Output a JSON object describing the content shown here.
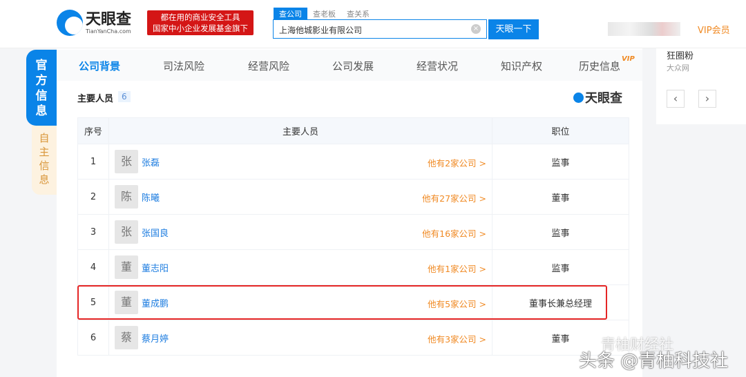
{
  "header": {
    "logo_cn": "天眼查",
    "logo_en": "TianYanCha.com",
    "slogan_line1": "都在用的商业安全工具",
    "slogan_line2": "国家中小企业发展基金旗下",
    "search_tabs": [
      "查公司",
      "查老板",
      "查关系"
    ],
    "search_value": "上海他城影业有限公司",
    "search_button": "天眼一下",
    "vip_label": "VIP会员"
  },
  "side_tabs": {
    "official": "官方信息",
    "self": "自主信息"
  },
  "nav": {
    "tabs": [
      "公司背景",
      "司法风险",
      "经营风险",
      "公司发展",
      "经营状况",
      "知识产权",
      "历史信息"
    ],
    "vip_badge": "VIP"
  },
  "section": {
    "title": "主要人员",
    "count": "6",
    "brand": "天眼查"
  },
  "table": {
    "headers": [
      "序号",
      "主要人员",
      "职位"
    ],
    "rows": [
      {
        "no": "1",
        "avatar": "张",
        "name": "张磊",
        "others": "他有2家公司 >",
        "position": "监事"
      },
      {
        "no": "2",
        "avatar": "陈",
        "name": "陈曦",
        "others": "他有27家公司 >",
        "position": "董事"
      },
      {
        "no": "3",
        "avatar": "张",
        "name": "张国良",
        "others": "他有16家公司 >",
        "position": "监事"
      },
      {
        "no": "4",
        "avatar": "董",
        "name": "董志阳",
        "others": "他有1家公司 >",
        "position": "监事"
      },
      {
        "no": "5",
        "avatar": "董",
        "name": "董成鹏",
        "others": "他有5家公司 >",
        "position": "董事长兼总经理"
      },
      {
        "no": "6",
        "avatar": "蔡",
        "name": "蔡月婷",
        "others": "他有3家公司 >",
        "position": "董事"
      }
    ]
  },
  "right": {
    "title": "狂圈粉",
    "source": "大众网"
  },
  "watermark": {
    "line1": "青柚财经社",
    "line2": "头条 @青柚科技社"
  },
  "colors": {
    "primary": "#0a84e8",
    "highlight": "#e52525",
    "orange": "#f08a24"
  }
}
